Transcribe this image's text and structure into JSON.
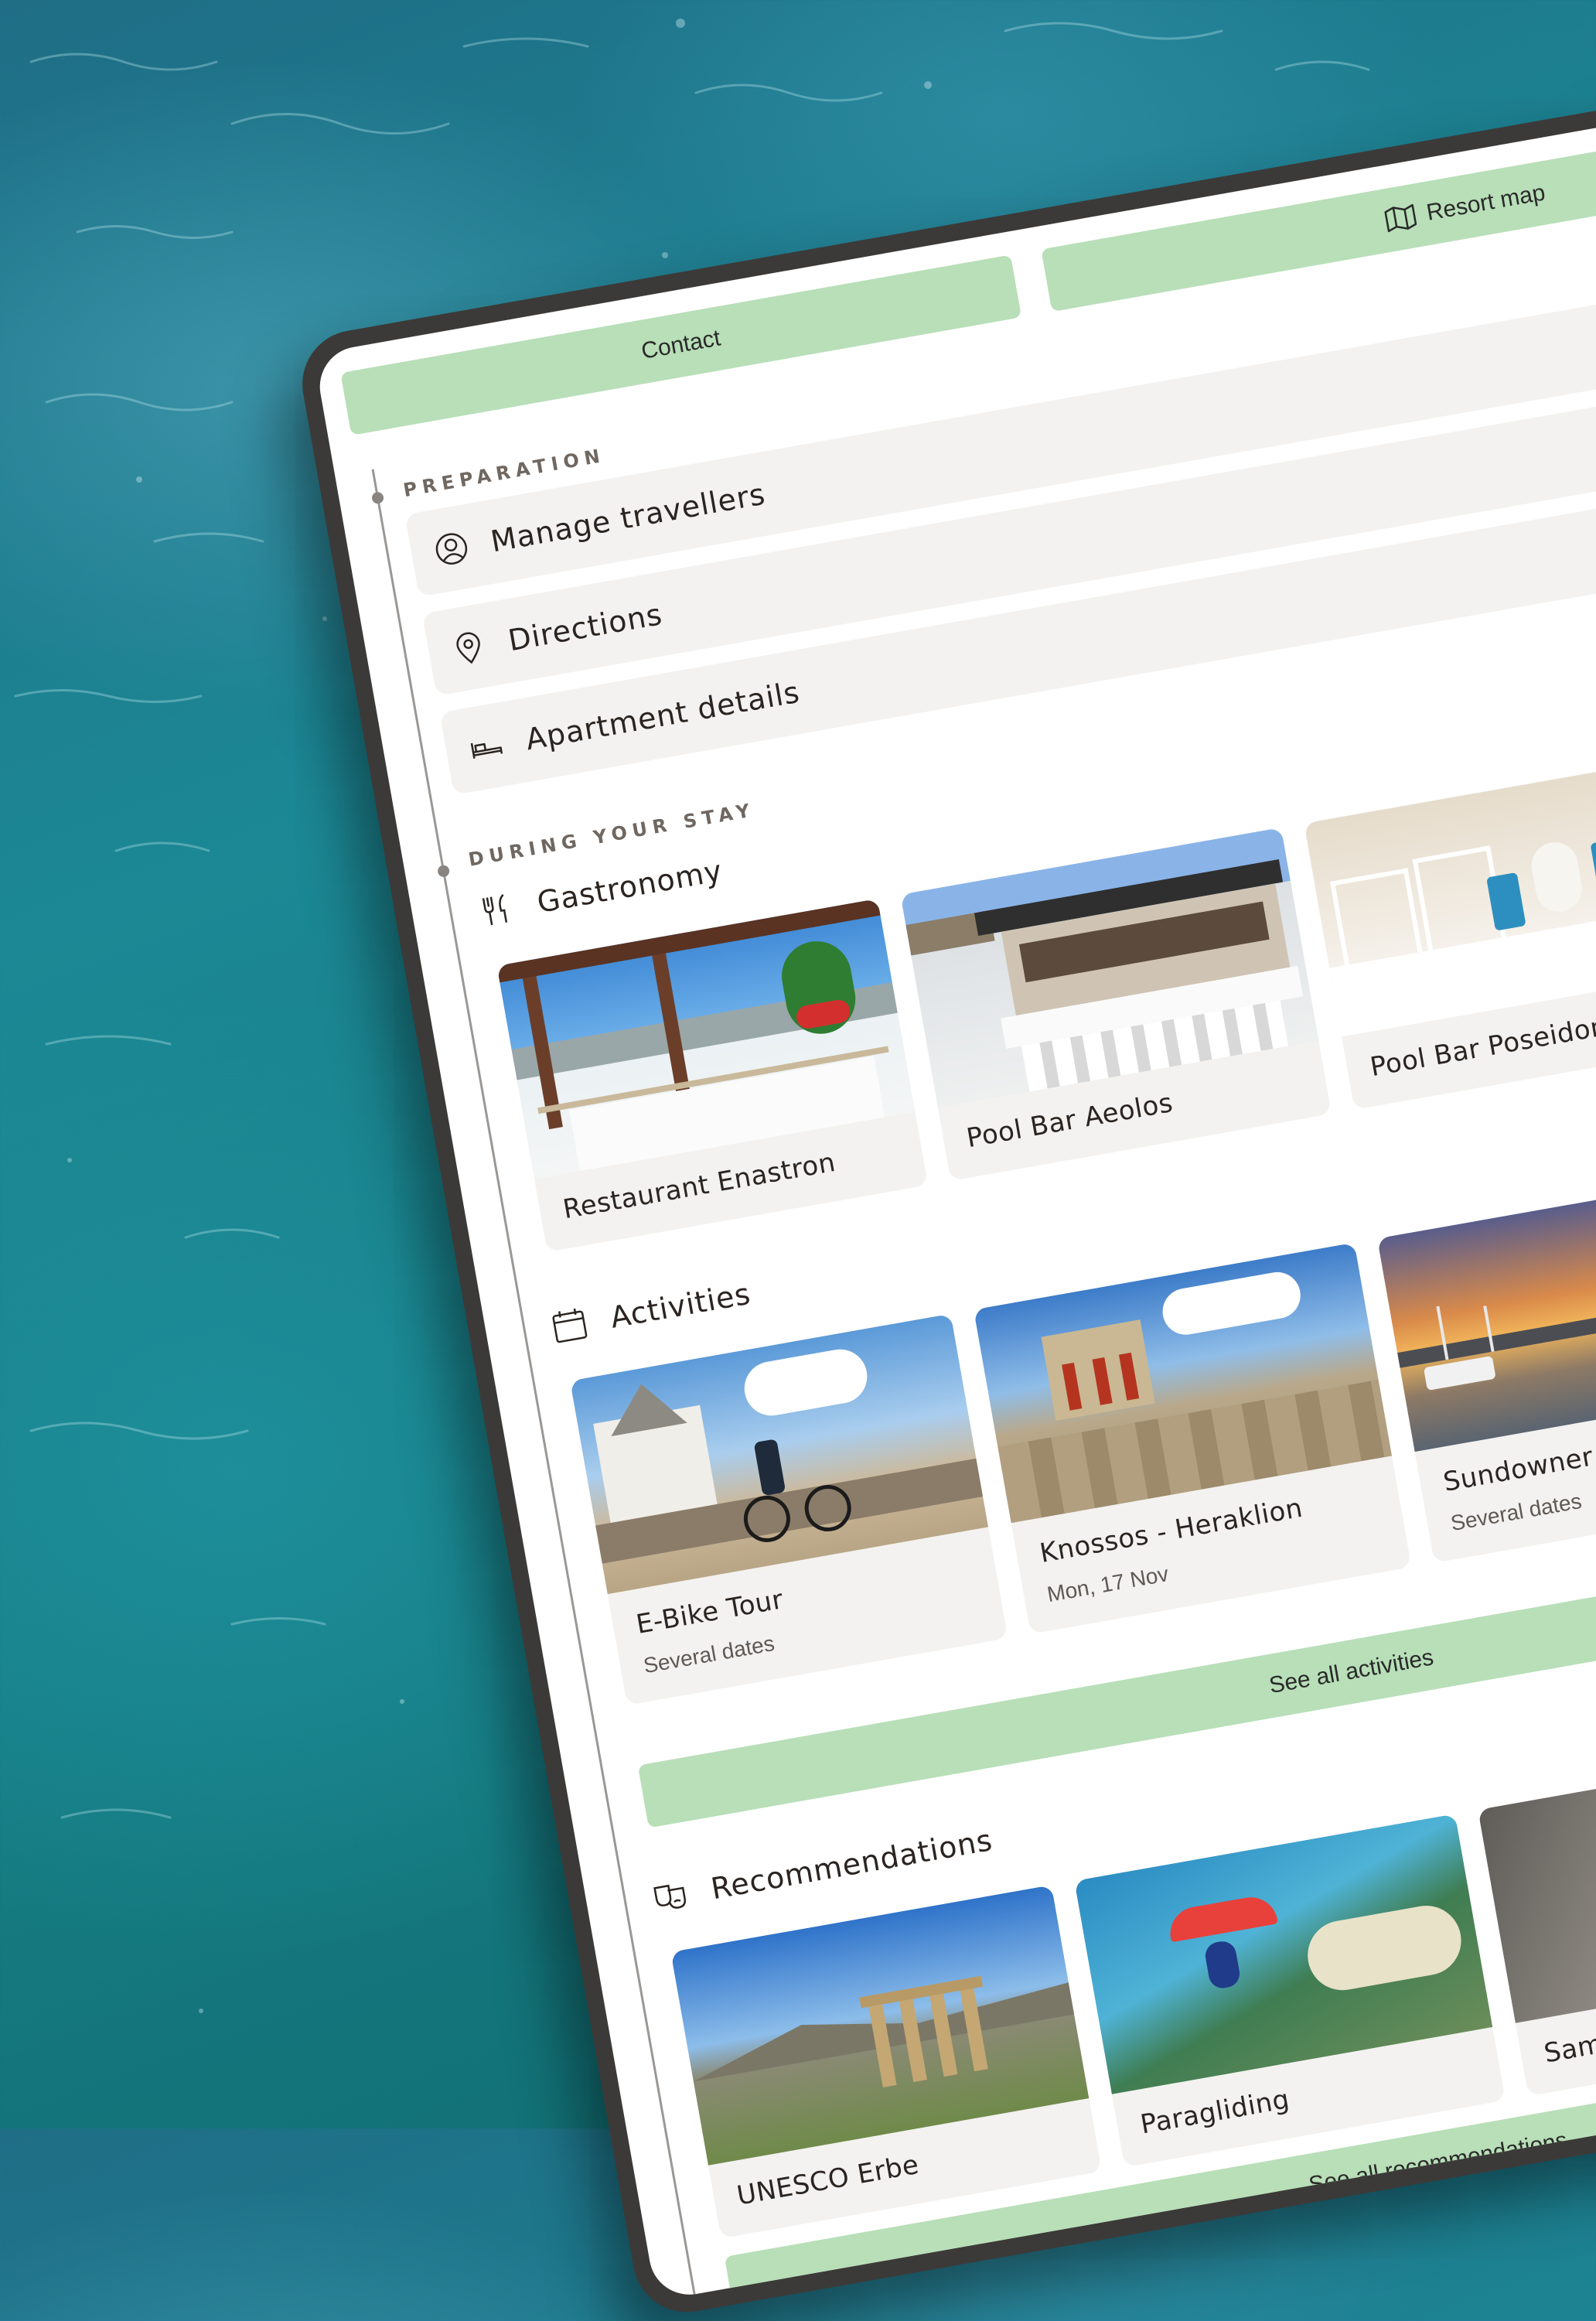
{
  "header": {
    "contact_label": "Contact",
    "resort_map_label": "Resort map"
  },
  "preparation": {
    "label": "PREPARATION",
    "items": [
      {
        "label": "Manage travellers",
        "icon": "user-circle-icon"
      },
      {
        "label": "Directions",
        "icon": "map-pin-icon"
      },
      {
        "label": "Apartment details",
        "icon": "bed-icon"
      }
    ]
  },
  "stay": {
    "label": "DURING YOUR STAY",
    "gastronomy": {
      "title": "Gastronomy",
      "icon": "cutlery-icon",
      "cards": [
        {
          "title": "Restaurant Enastron"
        },
        {
          "title": "Pool Bar Aeolos"
        },
        {
          "title": "Pool Bar Poseidon"
        }
      ]
    },
    "activities": {
      "title": "Activities",
      "icon": "calendar-icon",
      "cards": [
        {
          "title": "E-Bike Tour",
          "sub": "Several dates"
        },
        {
          "title": "Knossos - Heraklion",
          "sub": "Mon, 17 Nov"
        },
        {
          "title": "Sundowner Rethymn",
          "sub": "Several dates"
        }
      ],
      "see_all": "See all activities"
    },
    "recommendations": {
      "title": "Recommendations",
      "icon": "theater-masks-icon",
      "cards": [
        {
          "title": "UNESCO Erbe"
        },
        {
          "title": "Paragliding"
        },
        {
          "title": "Samaria Sc"
        }
      ],
      "see_all": "See all recommendations"
    }
  },
  "colors": {
    "accent_green": "#b8dfb8",
    "card_bg": "#f3f2f0",
    "text_dark": "#2b2420",
    "device_frame": "#3c3a38"
  }
}
